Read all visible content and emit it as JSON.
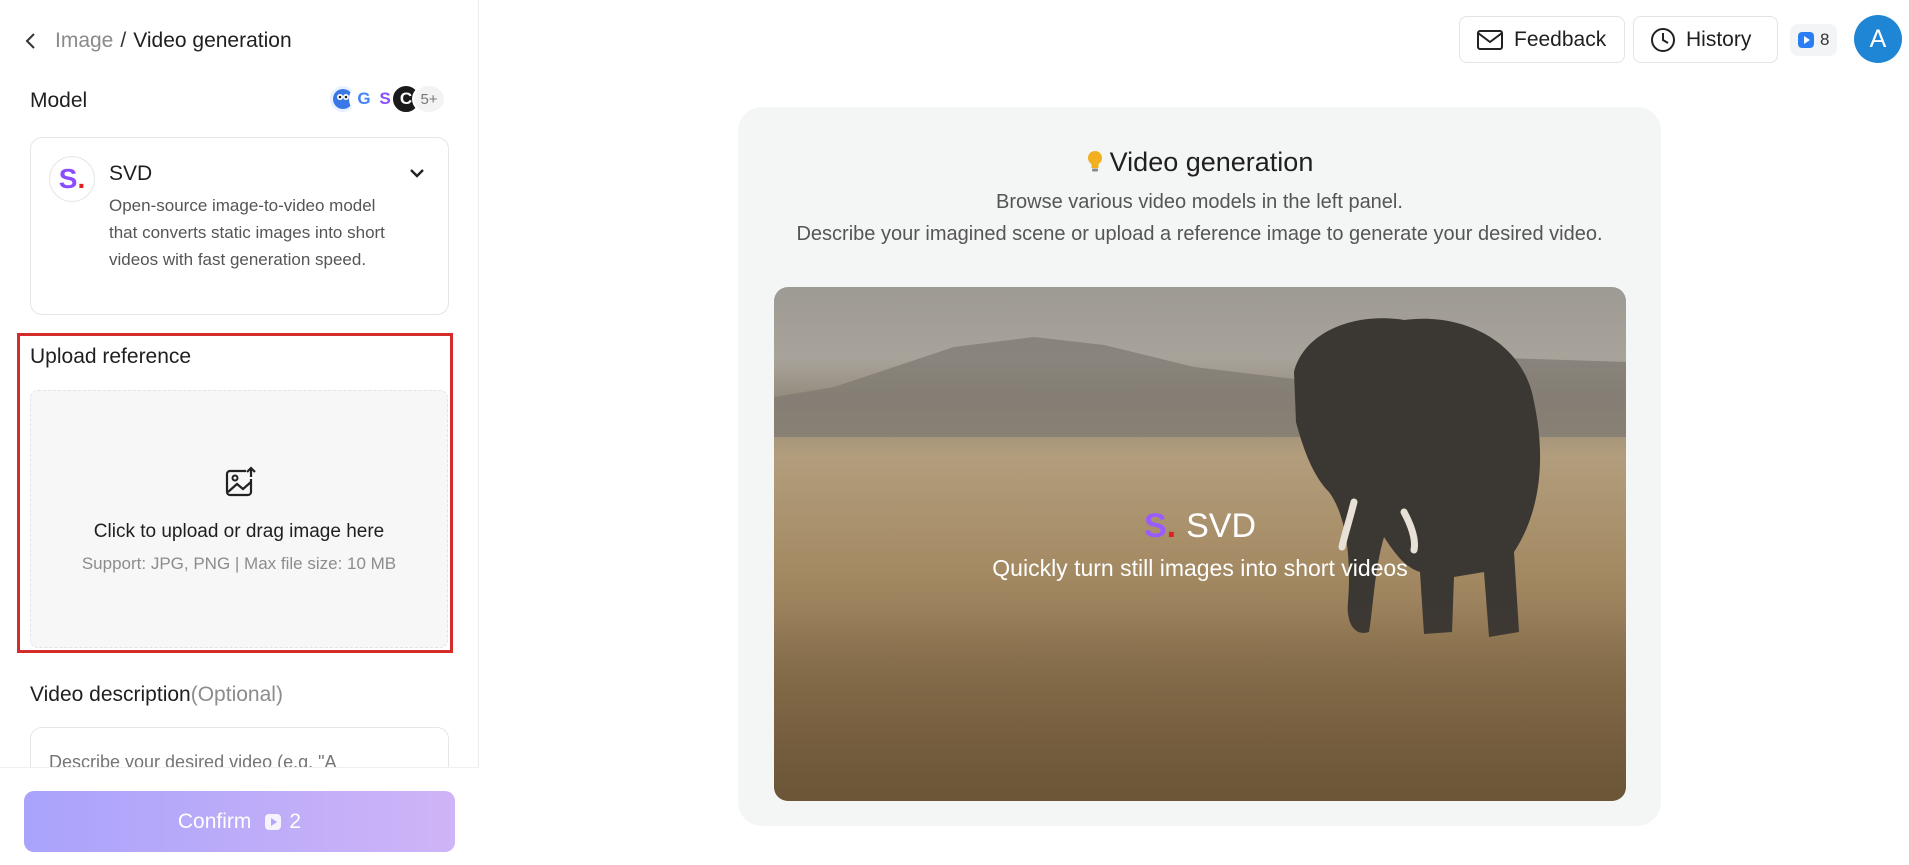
{
  "breadcrumb": {
    "parent": "Image",
    "separator": "/",
    "current": "Video generation"
  },
  "sidebar": {
    "model_label": "Model",
    "model_avatars_more": "5+",
    "model": {
      "logo_letter": "S",
      "name": "SVD",
      "description": "Open-source image-to-video model that converts static images into short videos with fast generation speed."
    },
    "upload": {
      "title": "Upload reference",
      "main_text": "Click to upload or drag image here",
      "support_text": "Support: JPG, PNG | Max file size: 10 MB"
    },
    "video_description": {
      "title": "Video description",
      "optional": "(Optional)",
      "placeholder": "Describe your desired video (e.g. \"A"
    },
    "confirm": {
      "label": "Confirm",
      "cost": "2"
    }
  },
  "header": {
    "feedback_label": "Feedback",
    "history_label": "History",
    "credits": "8",
    "avatar_letter": "A"
  },
  "main": {
    "title": "Video generation",
    "line1": "Browse various video models in the left panel.",
    "line2": "Describe your imagined scene or upload a reference image to generate your desired video.",
    "preview": {
      "brand_letter": "S",
      "brand_dot": ".",
      "brand_name": "SVD",
      "tagline": "Quickly turn still images into short videos"
    }
  },
  "colors": {
    "accent_purple": "#9a5cff",
    "highlight_red": "#d42b2b",
    "avatar_blue": "#1f86d6"
  }
}
